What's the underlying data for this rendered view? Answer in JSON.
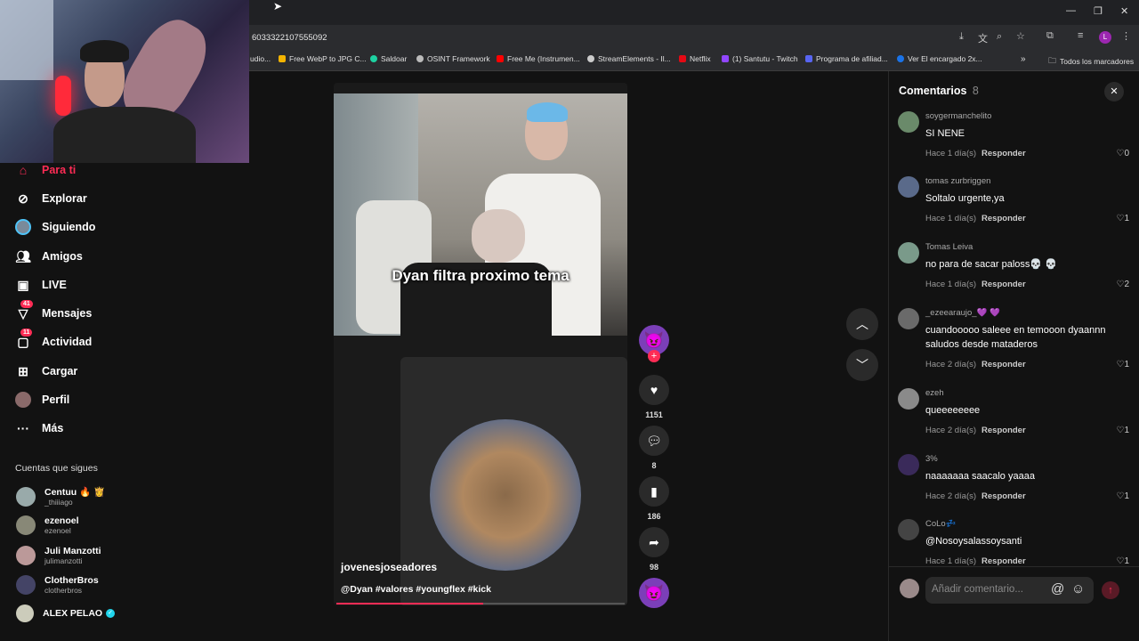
{
  "browser": {
    "url": "6033322107555092",
    "bookmarks": [
      "udio...",
      "Free WebP to JPG C...",
      "Saldoar",
      "OSINT Framework",
      "Free Me (Instrumen...",
      "StreamElements - Il...",
      "Netflix",
      "(1) Santutu - Twitch",
      "Programa de afiliad...",
      "Ver El encargado 2x..."
    ],
    "bookmarks_folder": "Todos los marcadores",
    "profile_initial": "L"
  },
  "sidebar": {
    "items": [
      {
        "label": "Para ti",
        "icon": "home-icon"
      },
      {
        "label": "Explorar",
        "icon": "compass-icon"
      },
      {
        "label": "Siguiendo",
        "icon": "following-avatar-icon"
      },
      {
        "label": "Amigos",
        "icon": "friends-icon"
      },
      {
        "label": "LIVE",
        "icon": "live-icon"
      },
      {
        "label": "Mensajes",
        "icon": "messages-icon",
        "badge": "41"
      },
      {
        "label": "Actividad",
        "icon": "activity-icon",
        "badge": "11"
      },
      {
        "label": "Cargar",
        "icon": "upload-icon"
      },
      {
        "label": "Perfil",
        "icon": "profile-avatar-icon"
      },
      {
        "label": "Más",
        "icon": "more-icon"
      }
    ],
    "following_title": "Cuentas que sigues",
    "accounts": [
      {
        "name": "Centuu 🔥 👸",
        "handle": "_thiiiago"
      },
      {
        "name": "ezenoel",
        "handle": "ezenoel"
      },
      {
        "name": "Juli Manzotti",
        "handle": "julimanzotti"
      },
      {
        "name": "ClotherBros",
        "handle": "clotherbros"
      },
      {
        "name": "ALEX PELAO",
        "handle": ""
      }
    ]
  },
  "video": {
    "caption_overlay": "Dyan filtra proximo tema",
    "author": "jovenesjoseadores",
    "description": "@Dyan #valores #youngflex #kick",
    "progress": 0.51,
    "likes": "1151",
    "comments": "8",
    "saves": "186",
    "shares": "98"
  },
  "comments": {
    "title": "Comentarios",
    "count": "8",
    "reply_label": "Responder",
    "items": [
      {
        "user": "soygermanchelito",
        "text": "SI NENE",
        "time": "Hace 1 día(s)",
        "likes": "0"
      },
      {
        "user": "tomas zurbriggen",
        "text": "Soltalo urgente,ya",
        "time": "Hace 1 día(s)",
        "likes": "1"
      },
      {
        "user": "Tomas Leiva",
        "text": "no para de sacar paloss💀 💀",
        "time": "Hace 1 día(s)",
        "likes": "2"
      },
      {
        "user": "_ezeearaujo_💜 💜",
        "text": "cuandooooo saleee en temooon dyaannn saludos desde mataderos",
        "time": "Hace 2 día(s)",
        "likes": "1"
      },
      {
        "user": "ezeh",
        "text": "queeeeeeee",
        "time": "Hace 2 día(s)",
        "likes": "1"
      },
      {
        "user": "3%",
        "text": "naaaaaaa saacalo yaaaa",
        "time": "Hace 2 día(s)",
        "likes": "1"
      },
      {
        "user": "CoLo💤",
        "text": "@Nosoysalassoysanti",
        "time": "Hace 1 día(s)",
        "likes": "1"
      }
    ],
    "input_placeholder": "Añadir comentario..."
  },
  "colors": {
    "accent": "#fe2c55",
    "bg": "#121212"
  }
}
